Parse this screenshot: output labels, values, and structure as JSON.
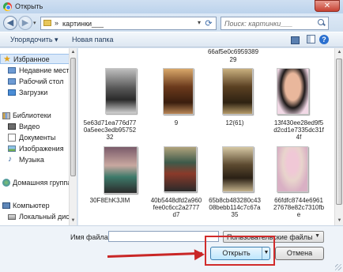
{
  "window": {
    "title": "Открыть",
    "close_symbol": "✕"
  },
  "address": {
    "back_symbol": "◀",
    "forward_symbol": "▶",
    "path_chevron": "»",
    "path": "картинки___",
    "search_placeholder": "Поиск: картинки___"
  },
  "toolbar": {
    "organize_label": "Упорядочить ▾",
    "new_folder_label": "Новая папка",
    "help_symbol": "?"
  },
  "nav": {
    "items": [
      {
        "label": "Избранное",
        "icon": "star-icon"
      },
      {
        "label": "Недавние места",
        "icon": "recent-places-icon"
      },
      {
        "label": "Рабочий стол",
        "icon": "desktop-icon"
      },
      {
        "label": "Загрузки",
        "icon": "downloads-icon"
      },
      {
        "label": "Библиотеки",
        "icon": "library-icon"
      },
      {
        "label": "Видео",
        "icon": "video-icon"
      },
      {
        "label": "Документы",
        "icon": "documents-icon"
      },
      {
        "label": "Изображения",
        "icon": "images-icon"
      },
      {
        "label": "Музыка",
        "icon": "music-icon"
      },
      {
        "label": "Домашняя группа",
        "icon": "homegroup-icon"
      },
      {
        "label": "Компьютер",
        "icon": "computer-icon"
      },
      {
        "label": "Локальный диск",
        "icon": "disk-icon"
      }
    ]
  },
  "files": {
    "top_partial": {
      "name_line1": "66af5e0c6959389",
      "name_line2": "29"
    },
    "items": [
      {
        "name": "5e63d71ea776d770a5eec3edb9575232",
        "line1": "5e63d71ea776d77",
        "line2": "0a5eec3edb95752",
        "line3": "32"
      },
      {
        "name": "9",
        "line1": "9",
        "line2": "",
        "line3": ""
      },
      {
        "name": "12(61)",
        "line1": "12(61)",
        "line2": "",
        "line3": ""
      },
      {
        "name": "13f430ee28ed9f5d2cd1e7335dc31f4f",
        "line1": "13f430ee28ed9f5",
        "line2": "d2cd1e7335dc31f",
        "line3": "4f"
      },
      {
        "name": "30F8EhK3JIM",
        "line1": "30F8EhK3JIM",
        "line2": "",
        "line3": ""
      },
      {
        "name": "40b5448dfd2a960fee0c6cc2a2777d7",
        "line1": "40b5448dfd2a960",
        "line2": "fee0c6cc2a2777",
        "line3": "d7"
      },
      {
        "name": "65b8cb483280c4308bebb114c7c67a35",
        "line1": "65b8cb483280c43",
        "line2": "08bebb114c7c67a",
        "line3": "35"
      },
      {
        "name": "66fdfc8744e696127678e82c7310fbe",
        "line1": "66fdfc8744e6961",
        "line2": "27678e82c7310fb",
        "line3": "e"
      }
    ]
  },
  "footer": {
    "filename_label": "Имя файла:",
    "filename_value": "",
    "filter_value": "Пользовательские файлы",
    "open_label": "Открыть",
    "cancel_label": "Отмена"
  },
  "colors": {
    "highlight": "#d12b2b",
    "accent": "#3c7fb1"
  }
}
